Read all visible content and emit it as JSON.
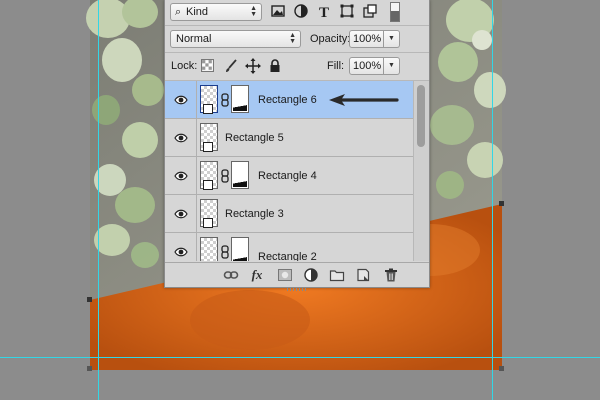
{
  "colors": {
    "panel_bg": "#d6d6d6",
    "selected_row": "#a6c8f3",
    "guide": "#32d6e6",
    "orange": "#d8641b"
  },
  "filter": {
    "kind_label": "Kind",
    "kind_icon": "search-icon",
    "filter_icons": [
      "image-filter-icon",
      "adjustment-filter-icon",
      "type-filter-icon",
      "shape-filter-icon",
      "smart-object-filter-icon",
      "filter-toggle-icon"
    ]
  },
  "blend": {
    "mode": "Normal",
    "opacity_label": "Opacity:",
    "opacity_value": "100%"
  },
  "lock": {
    "label": "Lock:",
    "icons": [
      "lock-transparent-pixels-icon",
      "lock-image-pixels-icon",
      "lock-position-icon",
      "lock-all-icon"
    ],
    "fill_label": "Fill:",
    "fill_value": "100%"
  },
  "layers": [
    {
      "name": "Rectangle 6",
      "selected": true,
      "mask": true
    },
    {
      "name": "Rectangle 5",
      "selected": false,
      "mask": false
    },
    {
      "name": "Rectangle 4",
      "selected": false,
      "mask": true
    },
    {
      "name": "Rectangle 3",
      "selected": false,
      "mask": false
    },
    {
      "name": "Rectangle 2",
      "selected": false,
      "mask": true
    }
  ],
  "footer_icons": [
    "link-layers-icon",
    "fx-layer-style-icon",
    "add-mask-icon",
    "adjustment-layer-icon",
    "new-group-icon",
    "new-layer-icon",
    "delete-layer-icon"
  ],
  "footer": {
    "fx_label": "fx"
  }
}
